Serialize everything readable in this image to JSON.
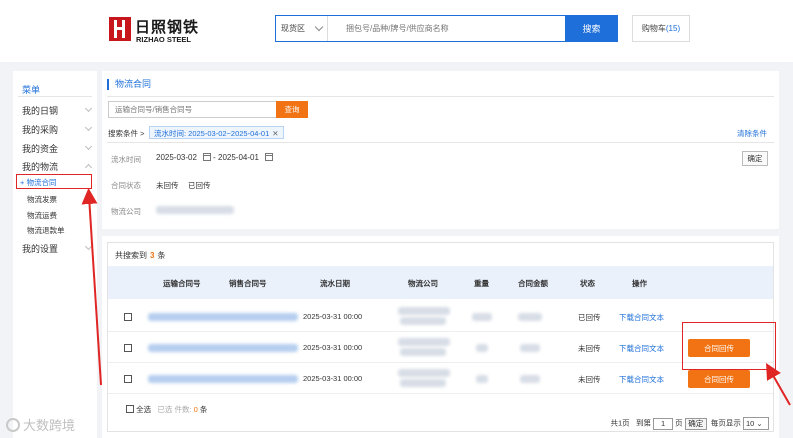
{
  "header": {
    "logo_cn": "日照钢铁",
    "logo_en": "RIZHAO STEEL",
    "search_scope": "现货区",
    "search_placeholder": "捆包号/品种/牌号/供应商名称",
    "search_button": "搜索",
    "cart_label": "购物车",
    "cart_count": "(15)"
  },
  "sidebar": {
    "title": "菜单",
    "items": [
      "我的日钢",
      "我的采购",
      "我的资金",
      "我的物流",
      "我的设置"
    ],
    "sub_items": [
      "+ 物流合同",
      "物流发票",
      "物流运费",
      "物流退款单"
    ]
  },
  "filter": {
    "page_title": "物流合同",
    "contract_placeholder": "运输合同号/销售合同号",
    "query_button": "查询",
    "conditions_label": "搜索条件 >",
    "condition_tag": "流水时间: 2025-03-02~2025-04-01",
    "condition_close": "✕",
    "clear_link": "清除条件",
    "date_label": "流水时间",
    "date_from": "2025-03-02",
    "date_sep": "-",
    "date_to": "2025-04-01",
    "confirm_button": "确定",
    "status_label": "合同状态",
    "status_options": [
      "未回传",
      "已回传"
    ],
    "company_label": "物流公司"
  },
  "results": {
    "count_prefix": "共搜索到",
    "count": "3",
    "count_suffix": "条",
    "columns": [
      "运输合同号",
      "销售合同号",
      "流水日期",
      "物流公司",
      "重量",
      "合同金额",
      "状态",
      "操作"
    ],
    "rows": [
      {
        "date": "2025-03-31 00:00",
        "status": "已回传",
        "action": "下载合同文本",
        "button": ""
      },
      {
        "date": "2025-03-31 00:00",
        "status": "未回传",
        "action": "下载合同文本",
        "button": "合同回传"
      },
      {
        "date": "2025-03-31 00:00",
        "status": "未回传",
        "action": "下载合同文本",
        "button": "合同回传"
      }
    ],
    "select_all": "全选",
    "selected_prefix": "已选 件数:",
    "selected_count": "0",
    "selected_suffix": "条"
  },
  "pager": {
    "total_pages": "共1页",
    "goto_prefix": "到第",
    "page_value": "1",
    "goto_suffix": "页",
    "ok_button": "确定",
    "per_page_label": "每页显示",
    "per_page_value": "10"
  },
  "watermark": "大数跨境",
  "colors": {
    "accent": "#1e6fd9",
    "orange": "#f27313",
    "highlight": "#e02525"
  }
}
